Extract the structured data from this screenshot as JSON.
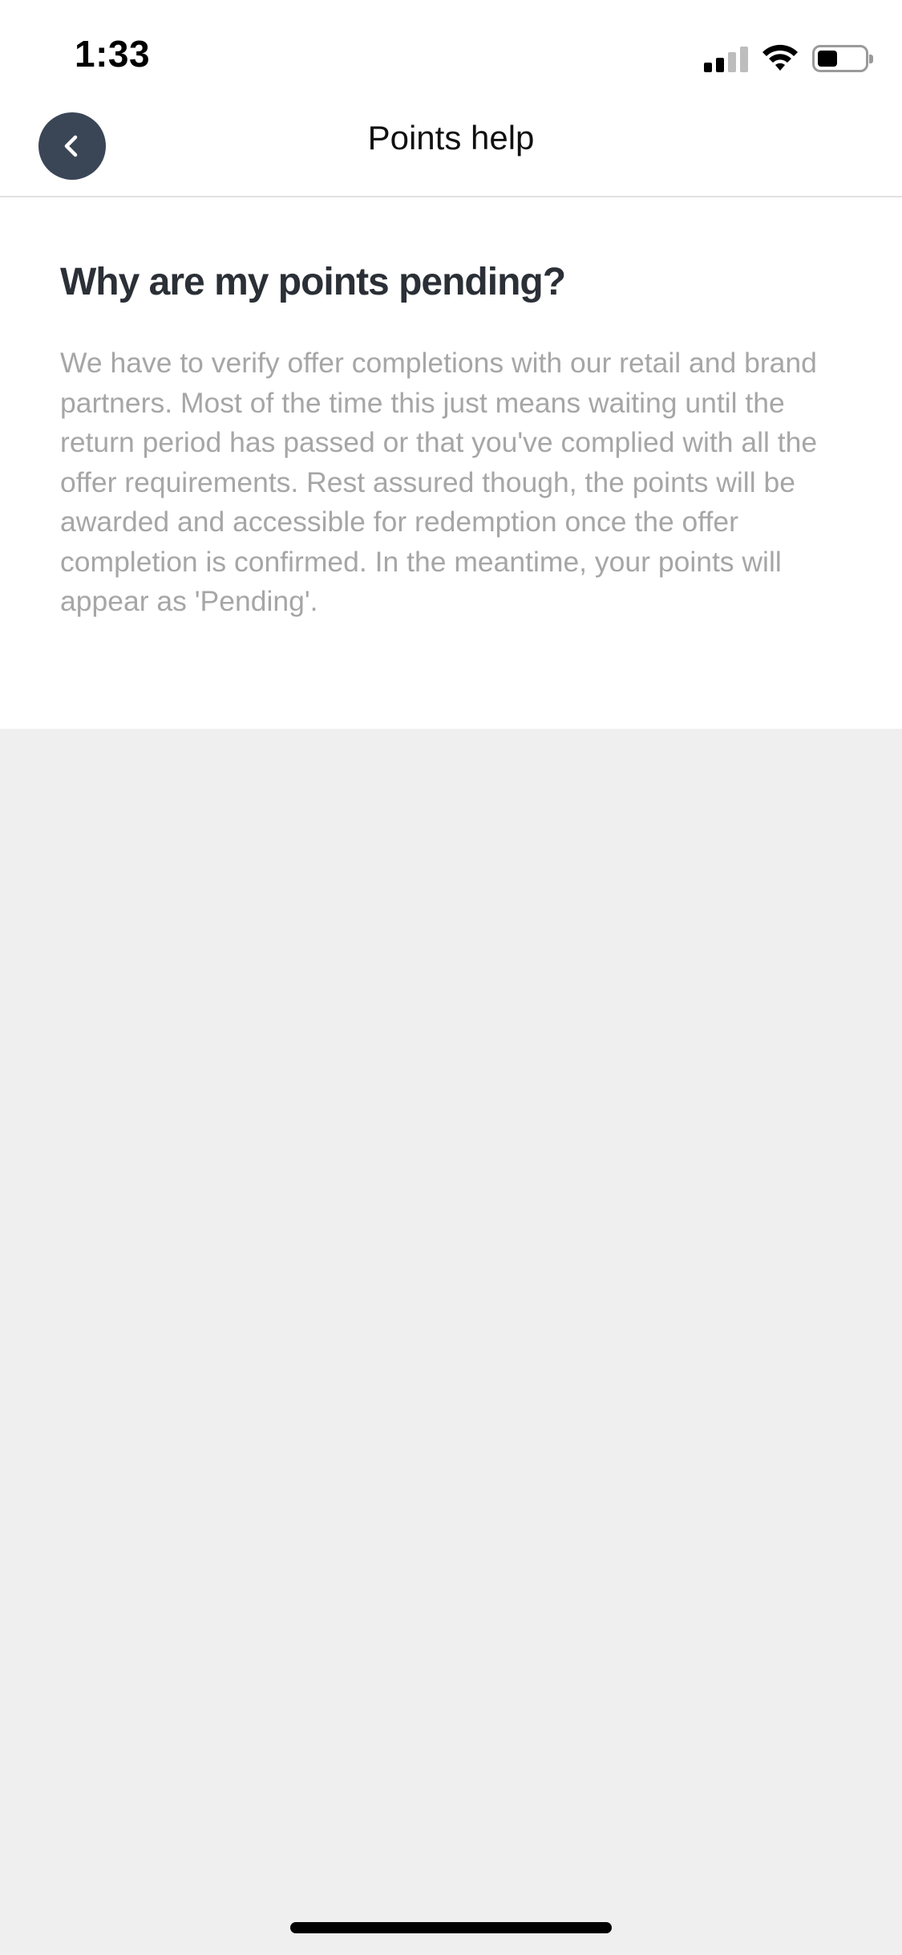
{
  "status_bar": {
    "time": "1:33",
    "icons": [
      "cellular-signal-icon",
      "wifi-icon",
      "battery-icon"
    ]
  },
  "header": {
    "back_icon": "chevron-left-icon",
    "title": "Points help"
  },
  "faq": {
    "question": "Why are my points pending?",
    "answer": "We have to verify offer completions with our retail and brand partners. Most of the time this just means waiting until the return period has passed or that you've complied with all the offer requirements. Rest assured though, the points will be awarded and accessible for redemption once the offer completion is confirmed. In the meantime, your points will appear as 'Pending'."
  },
  "colors": {
    "back_button_bg": "#3a4656",
    "question_text": "#2b2f36",
    "answer_text": "#a6a6a6",
    "page_background": "#efefef"
  }
}
